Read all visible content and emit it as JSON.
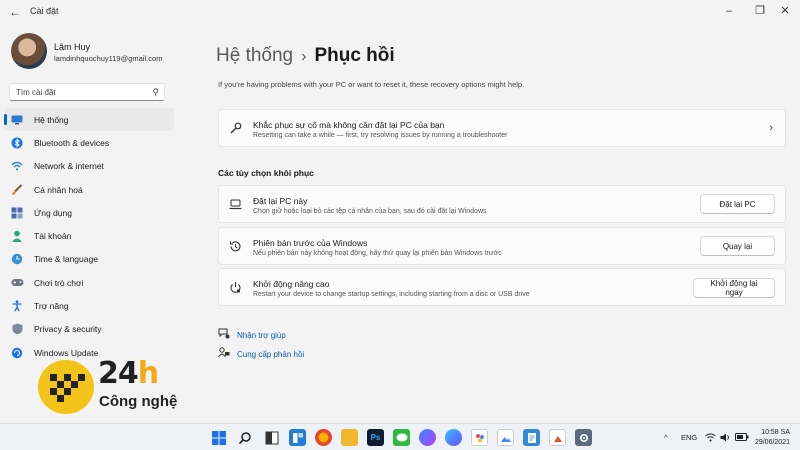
{
  "app": {
    "title": "Cài đặt"
  },
  "user": {
    "name": "Lâm Huy",
    "email": "lamdinhquochuy119@gmail.com"
  },
  "search": {
    "placeholder": "Tìm cài đặt"
  },
  "sidebar": {
    "items": [
      {
        "label": "Hệ thống",
        "icon": "monitor-icon",
        "active": true
      },
      {
        "label": "Bluetooth & devices",
        "icon": "bluetooth-icon"
      },
      {
        "label": "Network & internet",
        "icon": "wifi-icon"
      },
      {
        "label": "Cá nhân hoá",
        "icon": "brush-icon"
      },
      {
        "label": "Ứng dụng",
        "icon": "apps-icon"
      },
      {
        "label": "Tài khoản",
        "icon": "person-icon"
      },
      {
        "label": "Time & language",
        "icon": "globe-clock-icon"
      },
      {
        "label": "Chơi trò chơi",
        "icon": "gamepad-icon"
      },
      {
        "label": "Trợ năng",
        "icon": "accessibility-icon"
      },
      {
        "label": "Privacy & security",
        "icon": "shield-icon"
      },
      {
        "label": "Windows Update",
        "icon": "update-icon"
      }
    ]
  },
  "breadcrumb": {
    "parent": "Hệ thống",
    "separator": "›",
    "current": "Phục hồi"
  },
  "main": {
    "intro": "If you're having problems with your PC or want to reset it, these recovery options might help.",
    "troubleshoot": {
      "title": "Khắc phục sự cố mà không cần đặt lại PC của bạn",
      "desc": "Resetting can take a while — first, try resolving issues by running a troubleshooter"
    },
    "section_title": "Các tùy chọn khôi phục",
    "options": [
      {
        "title": "Đặt lại PC này",
        "desc": "Chọn giữ hoặc loại bỏ các tệp cá nhân của bạn, sau đó cài đặt lại Windows",
        "button": "Đặt lại PC",
        "icon": "reset-pc-icon"
      },
      {
        "title": "Phiên bản trước của Windows",
        "desc": "Nếu phiên bản này không hoạt động, hãy thử quay lại phiên bản Windows trước",
        "button": "Quay lại",
        "icon": "history-icon"
      },
      {
        "title": "Khởi động nâng cao",
        "desc": "Restart your device to change startup settings, including starting from a disc or USB drive",
        "button": "Khởi động lại ngay",
        "icon": "advanced-startup-icon"
      }
    ],
    "links": [
      {
        "label": "Nhận trợ giúp",
        "icon": "help-icon"
      },
      {
        "label": "Cung cấp phản hồi",
        "icon": "feedback-icon"
      }
    ]
  },
  "logo": {
    "text_24": "24",
    "text_h": "h",
    "text_sub": "Công nghệ"
  },
  "taskbar": {
    "language": "ENG",
    "time": "10:58 SA",
    "date": "29/06/2021",
    "apps": [
      "windows-start-icon",
      "search-icon",
      "file-explorer-icon",
      "widgets-icon",
      "firefox-icon",
      "folder-icon",
      "photoshop-icon",
      "line-icon",
      "messenger-icon",
      "edge-icon",
      "paint-icon",
      "image-viewer-icon",
      "notepad-icon",
      "photos-icon",
      "music-icon",
      "settings-icon"
    ]
  },
  "colors": {
    "accent": "#0067c0",
    "logo_yellow": "#f2c318"
  }
}
